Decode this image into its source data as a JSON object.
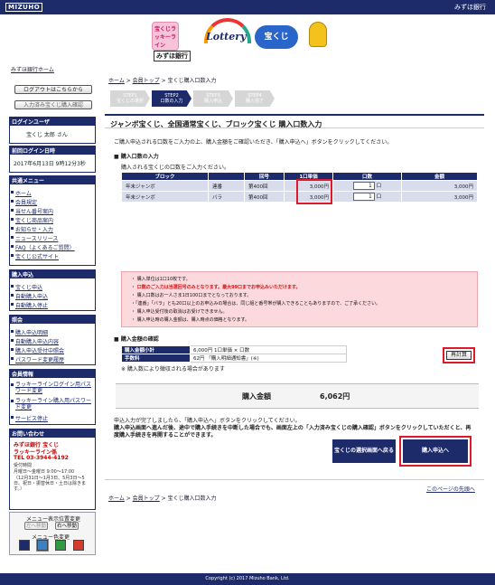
{
  "header": {
    "logo": "MIZUHO",
    "bank_name": "みずほ銀行"
  },
  "banner": {
    "tile1": "宝くじラッキーライン",
    "lottery": "Lottery",
    "takarakuji": "宝くじ",
    "mizuho_tag": "みずほ銀行"
  },
  "sidebar": {
    "home": "みずほ銀行ホーム",
    "logout": "ログアウトはこちらから",
    "confirm": "入力済み宝くじ購入確認",
    "login_user_title": "ログインユーザ",
    "user_name": "宝くじ 太郎 さん",
    "last_login_title": "前回ログイン日時",
    "last_login": "2017年6月13日 9時12分3秒",
    "common_menu_title": "共通メニュー",
    "common_items": [
      "ホーム",
      "会員規定",
      "当せん番号案内",
      "宝くじ商品案内",
      "お知らせ・入力",
      "ニュースリリース",
      "FAQ（よくあるご質問）",
      "宝くじ公式サイト"
    ],
    "purchase_title": "購入申込",
    "purchase_items": [
      "宝くじ申込",
      "自動購入申込",
      "自動購入停止"
    ],
    "inquiry_title": "照会",
    "inquiry_items": [
      "購入申込明細",
      "自動購入申込内容",
      "購入申込受付中照会",
      "パスワード変更履歴"
    ],
    "member_title": "会員情報",
    "member_items": [
      "ラッキーラインログイン用パスワード変更",
      "ラッキーライン購入用パスワード変更",
      "サービス停止"
    ],
    "contact_title": "お問い合わせ",
    "contact_name": "みずほ銀行 宝くじ",
    "contact_line": "ラッキーライン係",
    "contact_tel": "TEL 03-3944-4192",
    "hours_label": "受付時間",
    "hours": "月曜日～金曜日 9:00～17:00",
    "hours_note": "（12月31日～1月3日、5月3日～5日、祝日・振替休日・土日は除きます。）",
    "menu_display": "メニュー表示位置変更",
    "left_move": "左へ移動",
    "right_move": "右へ移動",
    "menu_color": "メニュー色変更"
  },
  "breadcrumb": {
    "home": "ホーム",
    "member_top": "会員トップ",
    "current": "宝くじ購入口数入力"
  },
  "steps": [
    {
      "n": "STEP1",
      "label": "宝くじの選択"
    },
    {
      "n": "STEP2",
      "label": "口数の入力"
    },
    {
      "n": "STEP3",
      "label": "購入申込"
    },
    {
      "n": "STEP4",
      "label": "購入完了"
    }
  ],
  "page_title": "ジャンボ宝くじ、全国通常宝くじ、ブロック宝くじ 購入口数入力",
  "intro": "ご購入申込される口数をご入力の上、購入金額をご確認いただき、「購入申込へ」ボタンをクリックしてください。",
  "input_section": {
    "title": "購入口数の入力",
    "note": "購入される宝くじの口数をご入力ください。",
    "headers": [
      "ブロック",
      "",
      "回号",
      "1口単価",
      "口数",
      "金額"
    ],
    "rows": [
      {
        "name": "年末ジャンボ",
        "kind": "連番",
        "issue": "第400回",
        "price": "3,000円",
        "qty": "1",
        "unit": "口",
        "amount": "3,000円"
      },
      {
        "name": "年末ジャンボ",
        "kind": "バラ",
        "issue": "第400回",
        "price": "3,000円",
        "qty": "1",
        "unit": "口",
        "amount": "3,000円"
      }
    ]
  },
  "notes": [
    "・ 購入単位は1口10枚です。",
    "・ 口数のご入力は当選回号のみとなります。最大99口までお申込みいただけます。",
    "・ 購入口数はお一人さま1日100口までとなっております。",
    "・「連番」「バラ」とも20口以上のお申込みの場合は、同じ組と番号帯が購入できることもありますので、ご了承ください。",
    "・ 購入申込受付後の取消はお受けできません。",
    "・ 購入申込時の購入金額は、購入時点の価格となります。"
  ],
  "confirm_section": {
    "title": "購入金額の確認",
    "subtotal_label": "購入金額小計",
    "subtotal": "6,000円 1口単価 × 口数",
    "fee_label": "手数料",
    "fee": "62円 「購入明細通知書」(※)",
    "footnote": "※ 購入数により徴収される場合があります",
    "recalc": "再計算"
  },
  "total": {
    "label": "購入金額",
    "value": "6,062円"
  },
  "instructions": {
    "line1": "申込入力が完了しましたら、「購入申込へ」ボタンをクリックしてください。",
    "line2": "購入申込画面へ進んだ後、途中で購入手続きを中断した場合でも、画面左上の「入力済み宝くじの購入確認」ボタンをクリックしていただくと、再度購入手続きを再開することができます。"
  },
  "buttons": {
    "back": "宝くじの選択画面へ戻る",
    "next": "購入申込へ"
  },
  "page_top": "このページの先頭へ",
  "footer": "Copyright (c) 2017 Mizuho Bank, Ltd.",
  "colors": {
    "navy": "#1d2b6b",
    "red_highlight": "#e0192a",
    "pink_note": "#fbd9dc"
  }
}
